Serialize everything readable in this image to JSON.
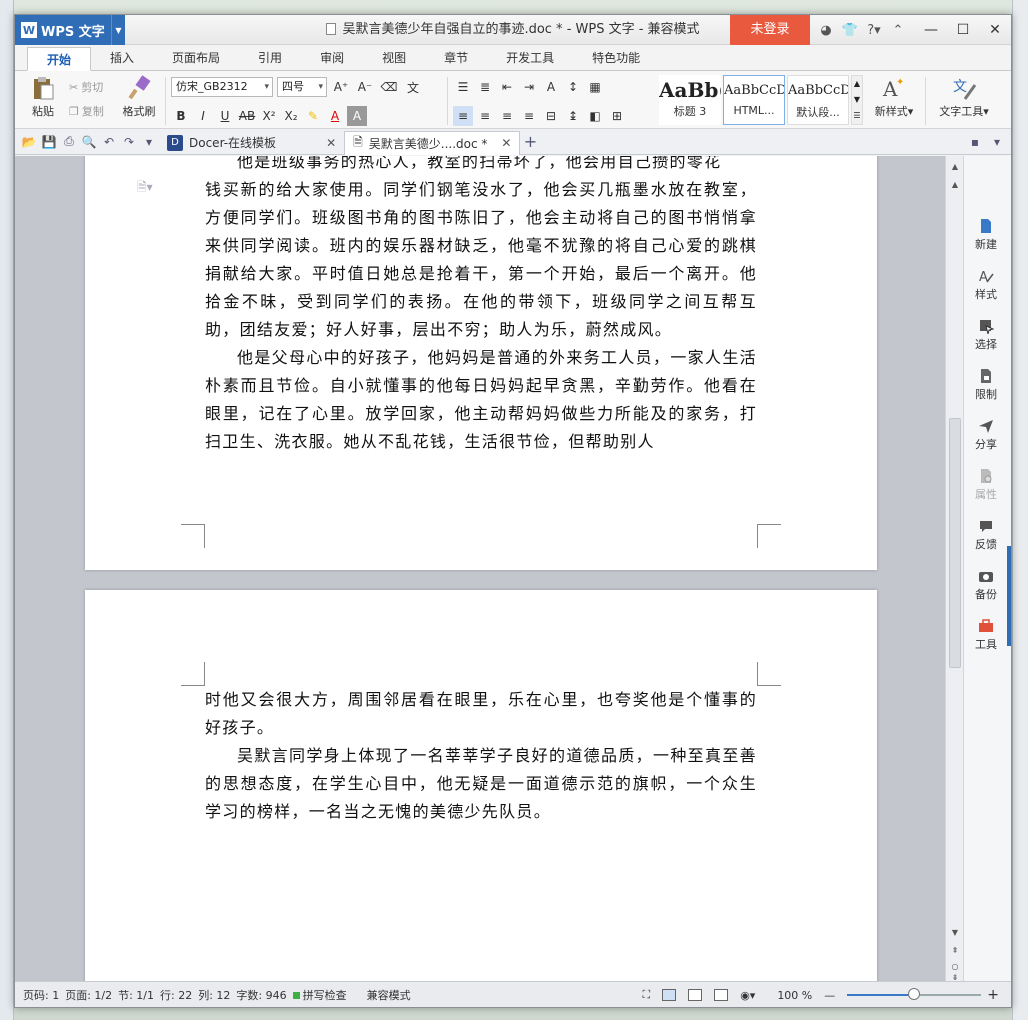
{
  "window": {
    "app_name": "WPS 文字",
    "title": "吴默言美德少年自强自立的事迹.doc * - WPS 文字 - 兼容模式",
    "login_label": "未登录"
  },
  "menu": {
    "tabs": [
      "开始",
      "插入",
      "页面布局",
      "引用",
      "审阅",
      "视图",
      "章节",
      "开发工具",
      "特色功能"
    ],
    "active": "开始"
  },
  "ribbon": {
    "paste_label": "粘贴",
    "cut_label": "剪切",
    "copy_label": "复制",
    "format_painter_label": "格式刷",
    "font_name": "仿宋_GB2312",
    "font_size": "四号",
    "styles": [
      {
        "sample": "AaBb(",
        "name": "标题 3"
      },
      {
        "sample": "AaBbCcDd",
        "name": "HTML..."
      },
      {
        "sample": "AaBbCcDd",
        "name": "默认段..."
      }
    ],
    "new_style_label": "新样式",
    "text_tools_label": "文字工具"
  },
  "doc_tabs": [
    {
      "label": "Docer-在线模板",
      "active": false
    },
    {
      "label": "吴默言美德少....doc *",
      "active": true
    }
  ],
  "document": {
    "page1_partial_top": "他是班级事务的热心人，教室的扫帚坏了，他会用自己攒的零花",
    "page1_paragraphs": [
      "钱买新的给大家使用。同学们钢笔没水了，他会买几瓶墨水放在教室，方便同学们。班级图书角的图书陈旧了，他会主动将自己的图书悄悄拿来供同学阅读。班内的娱乐器材缺乏，他毫不犹豫的将自己心爱的跳棋捐献给大家。平时值日她总是抢着干，第一个开始，最后一个离开。他拾金不昧，受到同学们的表扬。在他的带领下，班级同学之间互帮互助，团结友爱；好人好事，层出不穷；助人为乐，蔚然成风。",
      "他是父母心中的好孩子，他妈妈是普通的外来务工人员，一家人生活朴素而且节俭。自小就懂事的他每日妈妈起早贪黑，辛勤劳作。他看在眼里，记在了心里。放学回家，他主动帮妈妈做些力所能及的家务，打扫卫生、洗衣服。她从不乱花钱，生活很节俭，但帮助别人"
    ],
    "page2_paragraphs": [
      "时他又会很大方，周围邻居看在眼里，乐在心里，也夸奖他是个懂事的好孩子。",
      "吴默言同学身上体现了一名莘莘学子良好的道德品质，一种至真至善的思想态度，在学生心目中，他无疑是一面道德示范的旗帜，一个众生学习的榜样，一名当之无愧的美德少先队员。"
    ]
  },
  "sidebar": {
    "items": [
      "新建",
      "样式",
      "选择",
      "限制",
      "分享",
      "属性",
      "反馈",
      "备份",
      "工具"
    ]
  },
  "status": {
    "page_num": "页码: 1",
    "pages": "页面: 1/2",
    "section": "节: 1/1",
    "row": "行: 22",
    "col": "列: 12",
    "word_count": "字数: 946",
    "spell_check": "拼写检查",
    "compat_mode": "兼容模式",
    "zoom": "100 %",
    "zoom_fraction": 0.5
  },
  "colors": {
    "accent": "#2f6db6",
    "login": "#e8593e"
  }
}
